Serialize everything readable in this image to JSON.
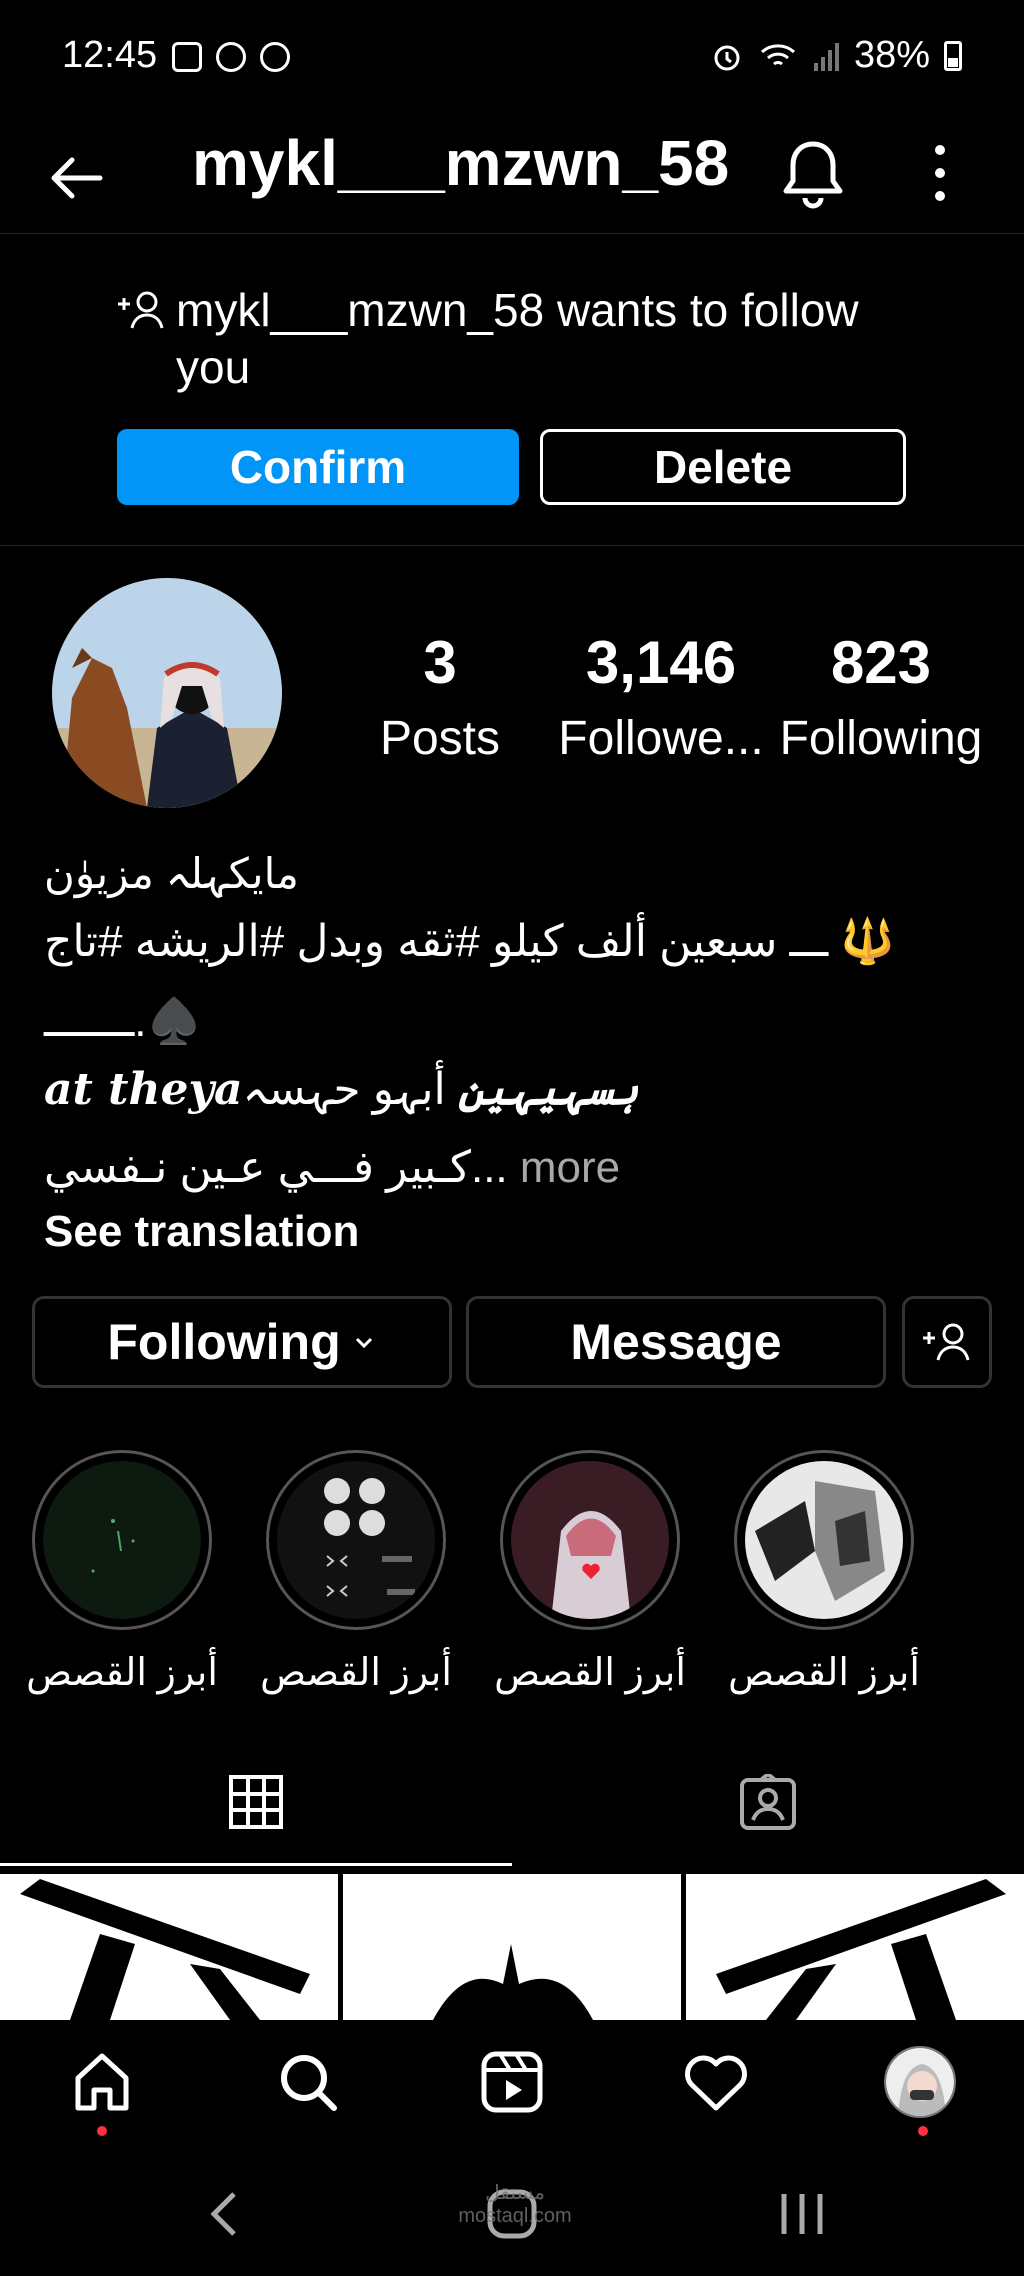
{
  "status_bar": {
    "time": "12:45",
    "battery": "38%",
    "icons": [
      "gallery-icon",
      "instagram-icon",
      "app-icon",
      "alarm-icon",
      "wifi-icon",
      "signal-icon",
      "battery-icon"
    ]
  },
  "header": {
    "username": "mykl___mzwn_58",
    "icons": [
      "back-arrow-icon",
      "bell-icon",
      "more-vertical-icon"
    ]
  },
  "follow_request": {
    "message": "mykl___mzwn_58 wants to follow you",
    "confirm_label": "Confirm",
    "delete_label": "Delete"
  },
  "profile": {
    "stats": [
      {
        "value": "3",
        "label": "Posts"
      },
      {
        "value": "3,146",
        "label": "Followe..."
      },
      {
        "value": "823",
        "label": "Following"
      }
    ],
    "bio": {
      "name": "مايكہلہ مزيۈن",
      "line1": "ـــ سبعين ألف كيلو  #ثقه وبدل #الريشه #تاج 🔱",
      "line2": "ـــــــ.♠️",
      "line3_latin": "at theyaہسہیہین",
      "line3_arabic": "أبہو حہسہ",
      "line4": "كـبير فـــي عـين نـفسي...",
      "more": "more",
      "see_translation": "See translation"
    },
    "buttons": {
      "following": "Following",
      "message": "Message"
    }
  },
  "highlights": [
    {
      "label": "أبرز القصص"
    },
    {
      "label": "أبرز القصص"
    },
    {
      "label": "أبرز القصص"
    },
    {
      "label": "أبرز القصص"
    }
  ],
  "tabs": [
    "grid-icon",
    "tagged-icon"
  ],
  "bottom_nav": [
    "home-icon",
    "search-icon",
    "reels-icon",
    "heart-icon",
    "profile-avatar"
  ],
  "watermark": "مستقل mostaql.com",
  "colors": {
    "primary_button": "#0095f6",
    "background": "#000000",
    "notification_dot": "#ff3040",
    "muted_text": "#a8a8a8"
  }
}
